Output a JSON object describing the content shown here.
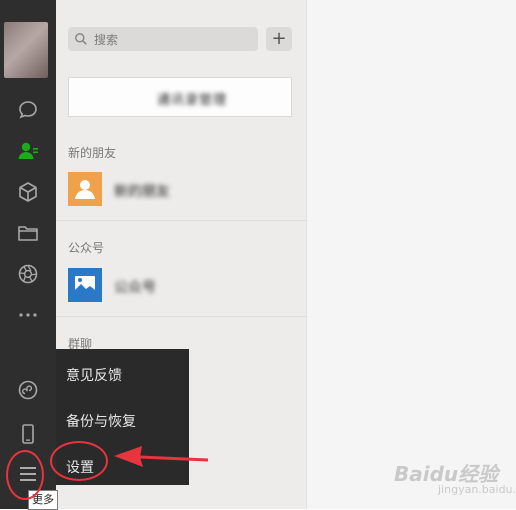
{
  "search": {
    "placeholder": "搜索"
  },
  "add_button_label": "+",
  "contact_manager_label": "通讯录管理",
  "sections": {
    "new_friends": {
      "header": "新的朋友",
      "item": "新的朋友"
    },
    "official_accounts": {
      "header": "公众号",
      "item": "公众号"
    },
    "group_chats": {
      "header": "群聊"
    }
  },
  "menu": {
    "items": [
      "意见反馈",
      "备份与恢复",
      "设置"
    ]
  },
  "tooltip": "更多",
  "watermark": {
    "text": "Baidu经验",
    "sub": "jingyan.baidu.com"
  },
  "colors": {
    "accent_green": "#1aad19",
    "annotation_red": "#e7343d"
  },
  "rail_icons": [
    "avatar",
    "chat-icon",
    "contacts-icon",
    "cube-icon",
    "folder-icon",
    "aperture-icon",
    "more-dots-icon",
    "miniprogram-icon",
    "phone-icon",
    "menu-icon"
  ]
}
